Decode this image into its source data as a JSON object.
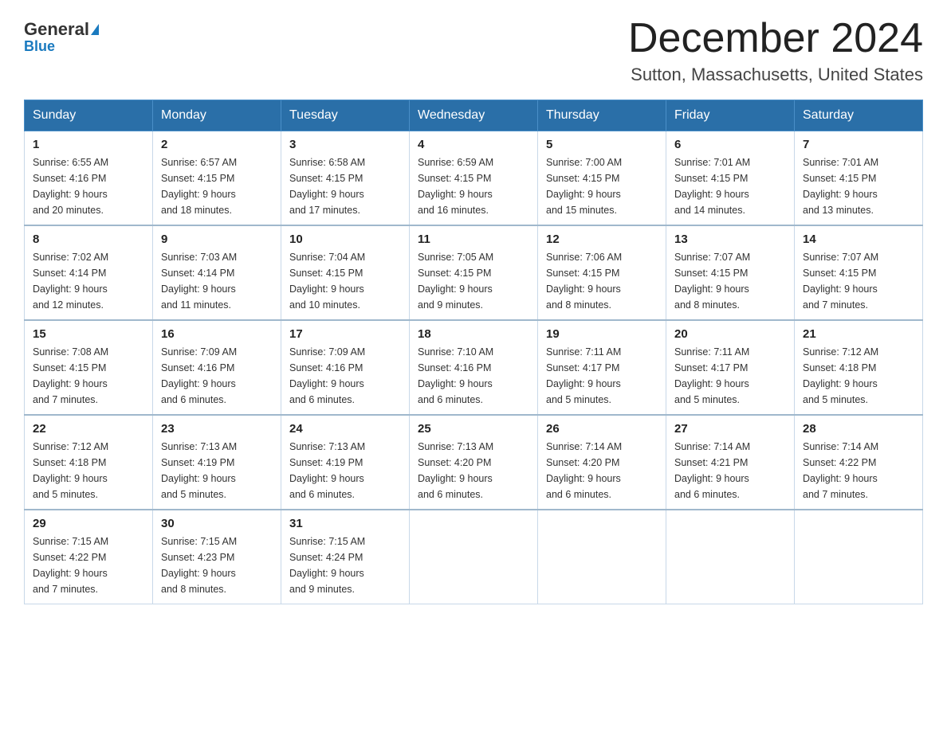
{
  "header": {
    "logo_general": "General",
    "logo_blue": "Blue",
    "title": "December 2024",
    "subtitle": "Sutton, Massachusetts, United States"
  },
  "days_of_week": [
    "Sunday",
    "Monday",
    "Tuesday",
    "Wednesday",
    "Thursday",
    "Friday",
    "Saturday"
  ],
  "weeks": [
    [
      {
        "day": "1",
        "sunrise": "6:55 AM",
        "sunset": "4:16 PM",
        "daylight": "9 hours and 20 minutes."
      },
      {
        "day": "2",
        "sunrise": "6:57 AM",
        "sunset": "4:15 PM",
        "daylight": "9 hours and 18 minutes."
      },
      {
        "day": "3",
        "sunrise": "6:58 AM",
        "sunset": "4:15 PM",
        "daylight": "9 hours and 17 minutes."
      },
      {
        "day": "4",
        "sunrise": "6:59 AM",
        "sunset": "4:15 PM",
        "daylight": "9 hours and 16 minutes."
      },
      {
        "day": "5",
        "sunrise": "7:00 AM",
        "sunset": "4:15 PM",
        "daylight": "9 hours and 15 minutes."
      },
      {
        "day": "6",
        "sunrise": "7:01 AM",
        "sunset": "4:15 PM",
        "daylight": "9 hours and 14 minutes."
      },
      {
        "day": "7",
        "sunrise": "7:01 AM",
        "sunset": "4:15 PM",
        "daylight": "9 hours and 13 minutes."
      }
    ],
    [
      {
        "day": "8",
        "sunrise": "7:02 AM",
        "sunset": "4:14 PM",
        "daylight": "9 hours and 12 minutes."
      },
      {
        "day": "9",
        "sunrise": "7:03 AM",
        "sunset": "4:14 PM",
        "daylight": "9 hours and 11 minutes."
      },
      {
        "day": "10",
        "sunrise": "7:04 AM",
        "sunset": "4:15 PM",
        "daylight": "9 hours and 10 minutes."
      },
      {
        "day": "11",
        "sunrise": "7:05 AM",
        "sunset": "4:15 PM",
        "daylight": "9 hours and 9 minutes."
      },
      {
        "day": "12",
        "sunrise": "7:06 AM",
        "sunset": "4:15 PM",
        "daylight": "9 hours and 8 minutes."
      },
      {
        "day": "13",
        "sunrise": "7:07 AM",
        "sunset": "4:15 PM",
        "daylight": "9 hours and 8 minutes."
      },
      {
        "day": "14",
        "sunrise": "7:07 AM",
        "sunset": "4:15 PM",
        "daylight": "9 hours and 7 minutes."
      }
    ],
    [
      {
        "day": "15",
        "sunrise": "7:08 AM",
        "sunset": "4:15 PM",
        "daylight": "9 hours and 7 minutes."
      },
      {
        "day": "16",
        "sunrise": "7:09 AM",
        "sunset": "4:16 PM",
        "daylight": "9 hours and 6 minutes."
      },
      {
        "day": "17",
        "sunrise": "7:09 AM",
        "sunset": "4:16 PM",
        "daylight": "9 hours and 6 minutes."
      },
      {
        "day": "18",
        "sunrise": "7:10 AM",
        "sunset": "4:16 PM",
        "daylight": "9 hours and 6 minutes."
      },
      {
        "day": "19",
        "sunrise": "7:11 AM",
        "sunset": "4:17 PM",
        "daylight": "9 hours and 5 minutes."
      },
      {
        "day": "20",
        "sunrise": "7:11 AM",
        "sunset": "4:17 PM",
        "daylight": "9 hours and 5 minutes."
      },
      {
        "day": "21",
        "sunrise": "7:12 AM",
        "sunset": "4:18 PM",
        "daylight": "9 hours and 5 minutes."
      }
    ],
    [
      {
        "day": "22",
        "sunrise": "7:12 AM",
        "sunset": "4:18 PM",
        "daylight": "9 hours and 5 minutes."
      },
      {
        "day": "23",
        "sunrise": "7:13 AM",
        "sunset": "4:19 PM",
        "daylight": "9 hours and 5 minutes."
      },
      {
        "day": "24",
        "sunrise": "7:13 AM",
        "sunset": "4:19 PM",
        "daylight": "9 hours and 6 minutes."
      },
      {
        "day": "25",
        "sunrise": "7:13 AM",
        "sunset": "4:20 PM",
        "daylight": "9 hours and 6 minutes."
      },
      {
        "day": "26",
        "sunrise": "7:14 AM",
        "sunset": "4:20 PM",
        "daylight": "9 hours and 6 minutes."
      },
      {
        "day": "27",
        "sunrise": "7:14 AM",
        "sunset": "4:21 PM",
        "daylight": "9 hours and 6 minutes."
      },
      {
        "day": "28",
        "sunrise": "7:14 AM",
        "sunset": "4:22 PM",
        "daylight": "9 hours and 7 minutes."
      }
    ],
    [
      {
        "day": "29",
        "sunrise": "7:15 AM",
        "sunset": "4:22 PM",
        "daylight": "9 hours and 7 minutes."
      },
      {
        "day": "30",
        "sunrise": "7:15 AM",
        "sunset": "4:23 PM",
        "daylight": "9 hours and 8 minutes."
      },
      {
        "day": "31",
        "sunrise": "7:15 AM",
        "sunset": "4:24 PM",
        "daylight": "9 hours and 9 minutes."
      },
      null,
      null,
      null,
      null
    ]
  ],
  "labels": {
    "sunrise": "Sunrise:",
    "sunset": "Sunset:",
    "daylight": "Daylight:"
  }
}
